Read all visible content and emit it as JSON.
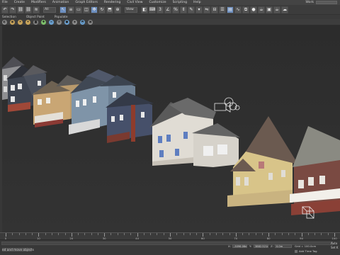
{
  "menubar": {
    "items": [
      "File",
      "Create",
      "Modifiers",
      "Animation",
      "Graph Editors",
      "Rendering",
      "Civil View",
      "Customize",
      "Scripting",
      "Help"
    ],
    "workspace_label": "Work"
  },
  "toolbar": {
    "buttons": [
      {
        "name": "undo-icon",
        "glyph": "↶"
      },
      {
        "name": "redo-icon",
        "glyph": "↷"
      },
      {
        "name": "link-icon",
        "glyph": "⛓"
      },
      {
        "name": "unlink-icon",
        "glyph": "⛓"
      },
      {
        "name": "bind-spacewarp-icon",
        "glyph": "≋"
      }
    ],
    "selection_filter": "All",
    "tools": [
      {
        "name": "select-object-icon",
        "glyph": "↖",
        "active": true
      },
      {
        "name": "select-by-name-icon",
        "glyph": "≡"
      },
      {
        "name": "rect-select-icon",
        "glyph": "▭"
      },
      {
        "name": "window-crossing-icon",
        "glyph": "◫"
      },
      {
        "name": "move-icon",
        "glyph": "✥",
        "active": true
      },
      {
        "name": "rotate-icon",
        "glyph": "↻"
      },
      {
        "name": "scale-icon",
        "glyph": "⬒"
      },
      {
        "name": "place-icon",
        "glyph": "⊕"
      }
    ],
    "reference_coord": "View",
    "right_tools": [
      {
        "name": "pivot-icon",
        "glyph": "◧"
      },
      {
        "name": "keyboard-shortcut-icon",
        "glyph": "⌨"
      },
      {
        "name": "snap-toggle-icon",
        "glyph": "3"
      },
      {
        "name": "angle-snap-icon",
        "glyph": "∠"
      },
      {
        "name": "percent-snap-icon",
        "glyph": "%"
      },
      {
        "name": "spinner-snap-icon",
        "glyph": "⇕"
      },
      {
        "name": "edit-named-sets-icon",
        "glyph": "✎"
      },
      {
        "name": "named-sets-icon",
        "glyph": "▾"
      },
      {
        "name": "mirror-icon",
        "glyph": "⇋"
      },
      {
        "name": "align-icon",
        "glyph": "⊟"
      },
      {
        "name": "layer-explorer-icon",
        "glyph": "☰"
      },
      {
        "name": "toggle-ribbon-icon",
        "glyph": "▤",
        "active": true
      },
      {
        "name": "curve-editor-icon",
        "glyph": "∿"
      },
      {
        "name": "schematic-view-icon",
        "glyph": "⧉"
      },
      {
        "name": "material-editor-icon",
        "glyph": "●"
      },
      {
        "name": "render-setup-icon",
        "glyph": "☕"
      },
      {
        "name": "rendered-frame-window-icon",
        "glyph": "▣"
      },
      {
        "name": "render-production-icon",
        "glyph": "☕"
      },
      {
        "name": "a360-render-icon",
        "glyph": "☁"
      }
    ]
  },
  "ribbon": {
    "tabs": [
      "Selection",
      "Object Paint",
      "Populate"
    ]
  },
  "toolbar2": {
    "icons": [
      {
        "name": "isolate-icon",
        "kind": "grey",
        "glyph": "◐"
      },
      {
        "name": "lock-selection-icon",
        "kind": "",
        "glyph": "◉"
      },
      {
        "name": "sun-icon",
        "kind": "",
        "glyph": "☀"
      },
      {
        "name": "light-icon",
        "kind": "",
        "glyph": "✦"
      },
      {
        "name": "camera-icon",
        "kind": "grey",
        "glyph": "◙"
      },
      {
        "name": "helper-icon",
        "kind": "green",
        "glyph": "✚"
      },
      {
        "name": "spacewarp-icon",
        "kind": "blue",
        "glyph": "≈"
      },
      {
        "name": "system-icon",
        "kind": "grey",
        "glyph": "⚙"
      },
      {
        "name": "sphere-icon",
        "kind": "blue",
        "glyph": "●"
      },
      {
        "name": "shapes-icon",
        "kind": "grey",
        "glyph": "◈"
      },
      {
        "name": "teapot-icon",
        "kind": "blue",
        "glyph": "◓"
      },
      {
        "name": "box-icon",
        "kind": "grey",
        "glyph": "▣"
      }
    ]
  },
  "timeline": {
    "frames": [
      0,
      10,
      20,
      30,
      40,
      50,
      60,
      70,
      80,
      90,
      100
    ]
  },
  "status": {
    "message": "ed and move objects",
    "x_label": "X:",
    "y_label": "Y:",
    "z_label": "Z:",
    "x_value": "-3096.06m",
    "y_value": "3882.521m",
    "z_value": "0.0m",
    "grid": "Grid = 100.0cm",
    "time_tag": "Add Time Tag",
    "auto_key": "Auto",
    "set_key": "Set K"
  },
  "colors": {
    "accent_active": "#6d8fc0",
    "viewport_bg": "#2e2e2e",
    "grid_line": "#3a3a3a"
  }
}
